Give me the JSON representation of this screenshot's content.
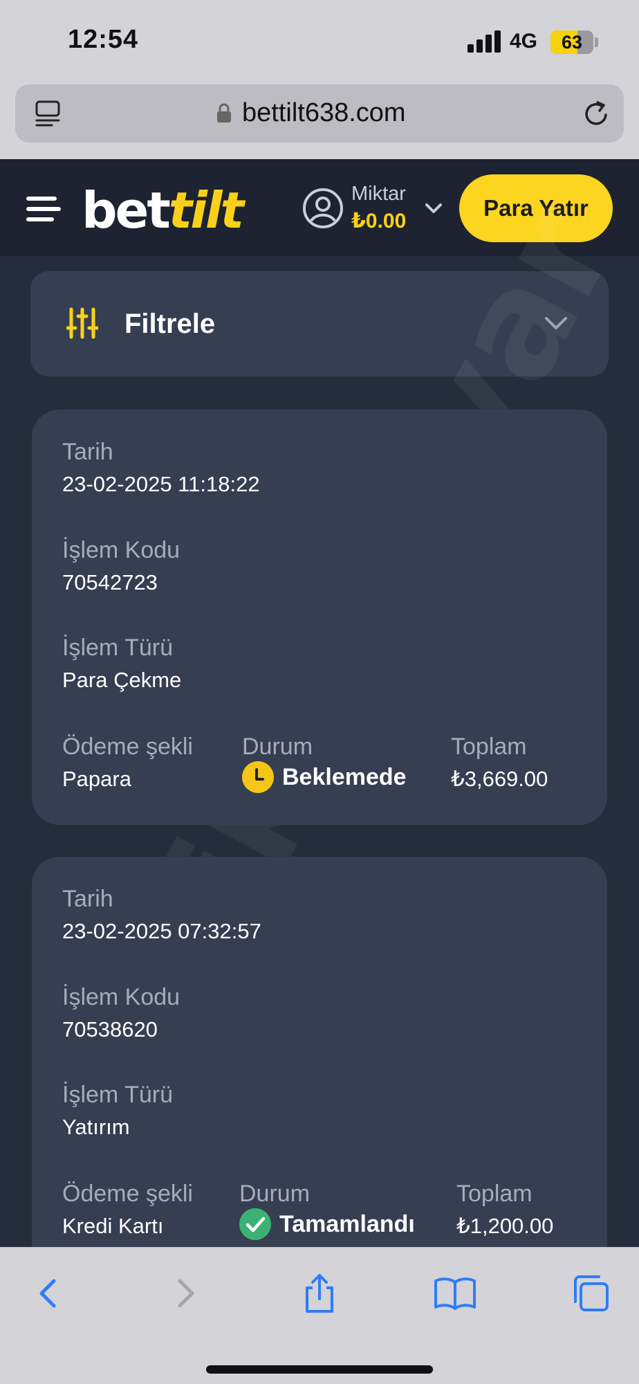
{
  "status_bar": {
    "time": "12:54",
    "network": "4G",
    "battery": "63",
    "battery_fill": 0.63
  },
  "browser": {
    "url": "bettilt638.com"
  },
  "header": {
    "logo_bet": "bet",
    "logo_tilt": "tilt",
    "amount_label": "Miktar",
    "amount_value": "₺0.00",
    "deposit_label": "Para Yatır"
  },
  "filter": {
    "label": "Filtrele"
  },
  "transactions": [
    {
      "date_label": "Tarih",
      "date": "23-02-2025 11:18:22",
      "code_label": "İşlem Kodu",
      "code": "70542723",
      "type_label": "İşlem Türü",
      "type": "Para Çekme",
      "payment_label": "Ödeme şekli",
      "payment": "Papara",
      "status_label": "Durum",
      "status": "Beklemede",
      "status_color": "#f5c518",
      "total_label": "Toplam",
      "total": "₺3,669.00"
    },
    {
      "date_label": "Tarih",
      "date": "23-02-2025 07:32:57",
      "code_label": "İşlem Kodu",
      "code": "70538620",
      "type_label": "İşlem Türü",
      "type": "Yatırım",
      "payment_label": "Ödeme şekli",
      "payment": "Kredi Kartı",
      "status_label": "Durum",
      "status": "Tamamlandı",
      "status_color": "#3bb273",
      "total_label": "Toplam",
      "total": "₺1,200.00"
    }
  ],
  "watermark": "şikayetvar",
  "colors": {
    "accent": "#fbd51f",
    "background": "#252c3b",
    "card": "#363e51"
  },
  "toolbar_icons": [
    "back-icon",
    "forward-icon",
    "share-icon",
    "bookmarks-icon",
    "tabs-icon"
  ]
}
